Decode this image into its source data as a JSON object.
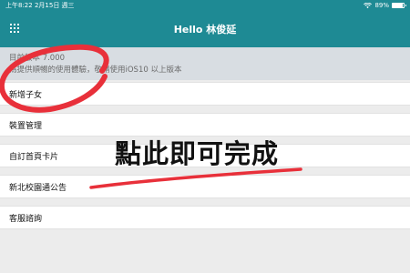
{
  "status_bar": {
    "time": "上午8:22",
    "date": "2月15日 週三",
    "battery_percent": "89%",
    "battery_level": 0.89
  },
  "header": {
    "title": "Hello 林俊延",
    "menu_icon": "grid-icon"
  },
  "notice": {
    "line1": "目前版本 7.000",
    "line2": "為提供順暢的使用體驗，敬請使用iOS10 以上版本"
  },
  "menu": {
    "items": [
      {
        "label": "新增子女"
      },
      {
        "label": "裝置管理"
      },
      {
        "label": "自訂首頁卡片"
      },
      {
        "label": "新北校園通公告"
      },
      {
        "label": "客服諮詢"
      }
    ]
  },
  "annotation": {
    "text": "點此即可完成",
    "circle_color": "#e8303a"
  },
  "colors": {
    "header_bg": "#1e8a94",
    "notice_bg": "#d8dde2",
    "page_bg": "#ececec"
  }
}
